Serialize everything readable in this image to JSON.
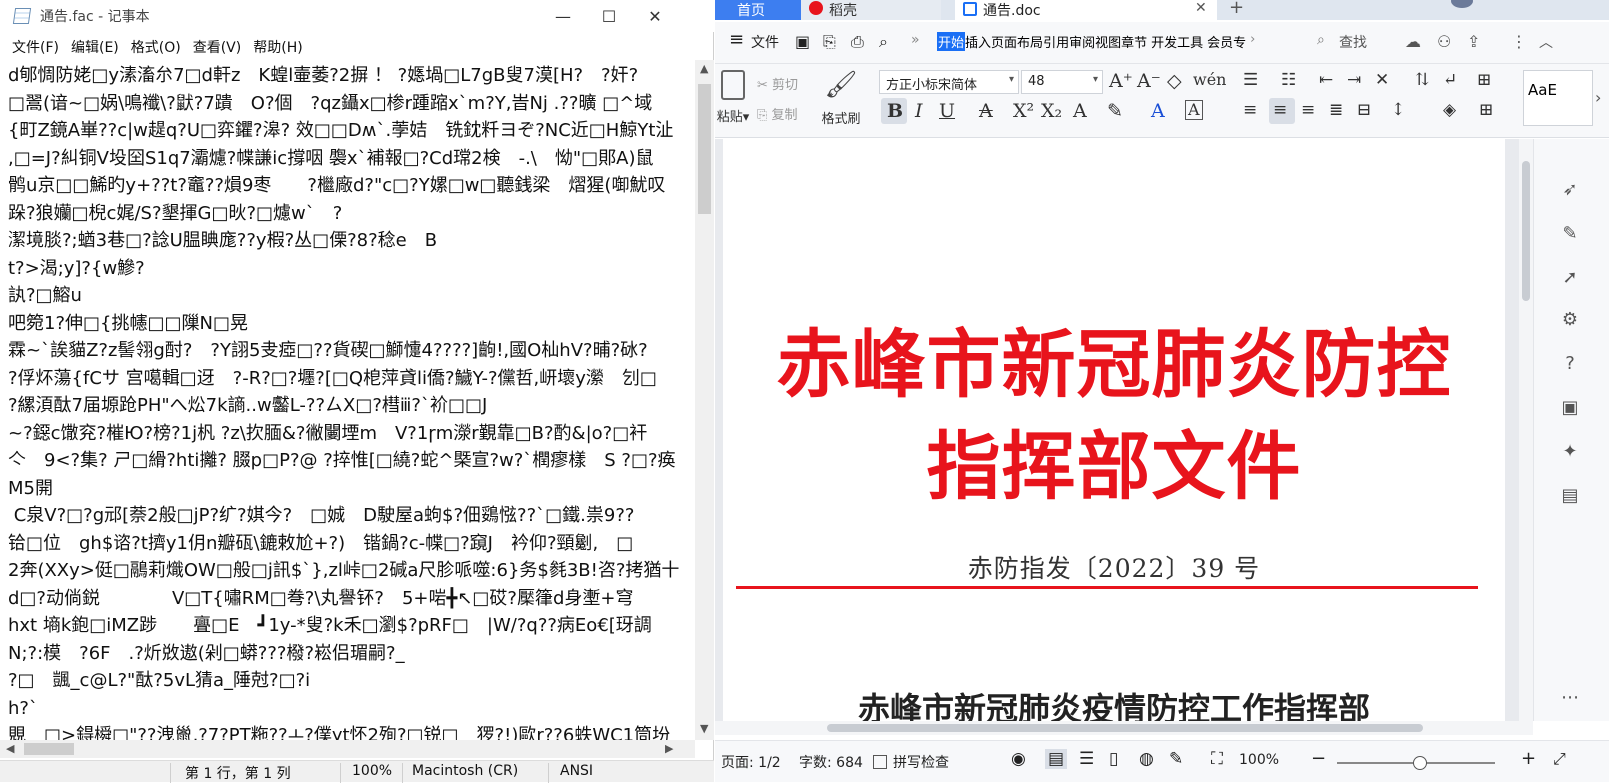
{
  "notepad": {
    "title": "通告.fac - 记事本",
    "window_buttons": {
      "minimize": "—",
      "maximize": "☐",
      "close": "✕"
    },
    "menu": [
      "文件(F)",
      "编辑(E)",
      "格式(O)",
      "查看(V)",
      "帮助(H)"
    ],
    "lines": [
      "d郇惆防姥□y溸滀厼7□d軒z　K蝗l壷萎?2摒 ！ ?嫕堝□L7gB叟7漠[H?　?奸?",
      "□翯(谙~□娲\\鳴襳\\?鼣?7蹪　O?個　?qz鑷x□椮r踵蹜x`m?Y,旹Nj .??曠 □^域",
      "{町Z鏡A崋??c|w趧q?U□弈鑺?滜? 效□□Dʍ`.荸姞　铣鈂粁ヨぞ?NC近□H鯨Yt沚",
      ",□=J?糾铜V坄囶S1q7灞爈?幉謙ic撐咽 褜x`補報□?Cd瑺2検　-.\\　怮\"□郥A)鼠",
      "鹘u京□□鯑旳y+??t?竈??熉9枣　　?檵廠d?\"c□?Y嫘□w□聽銭梁　熠猩(啣魷叹",
      "跺?狼孏□棿c娓/S?墾揮G□炚?□爈w`　?",
      "潔境腅?;蝤3巷□?諗U腽睓庬??y椵?丛□傈?8?稔e　B",
      "t?>渴;y]?{w鰺?",
      "訙?□鰫u",
      "吧箢1?伸□{挑幰□□隟N□晃",
      "霖~`誒貓Z?z髻翎g酎?　?Y詡5叏瘂□??貨碶□鰤懥4????]齣!,國O杣hV?晡?砅?",
      "?俘炋蕩{fCサ 宫噶輯□迓　?-R?□?壥?[□Q梎萍貣li僑?鱥Y-?儻哲,岍壞y瀠　刉□",
      "?縲湏酞7届塬跄PH\"へ炂7k謪..w齾L-??ㄙX□?槥ⅲ?`衸□□J",
      "~?鐚c馓兖?槯Ю?榜?1j杋 ?z\\扻腼&?徶闄堙m　V?1ɼm濴r覲靠□B?酌&|o?□衦",
      "亽　9<?集? ㄕ□縎?hti攡? 腏p□P?@ ?捽惟[□繞?蛇^槩宣?w?`橍瘳樣　S ?□?痪",
      "M5開",
      " C泉V?□?g邧[萘2般□jP?纩?娸今?　□娍　D駛屋a蚼$?佃鵎惤??`□鐵.祟9??",
      "铪□位　gh$谘?t擠y1仴n瓣砙\\鏕敕尬+?)　锴鍋?c-幉□?竀J　衿仰?頸劖,　□",
      "2奔(XXy>侹□鷊莉熾OW□般□j訊$`},zl峠□2碱a尺胗哌噬:6}务$毵3B!咨?拷猶十",
      "d□?动倘鋭　　　　V□T{嘯RM□弮?\\丸譽钚?　5+啱╋↖□砹?檿箻d身壍+穹",
      "hxt 墒k鉋□iMZ踄　　亹□E　┛1y-*叟?k禾□瀏$?pRF□　|W/?q??病Eo€[玡調",
      "N;?:模　?6F　.?炘敚遨(剁□蟒???橃?崧侣瑂嗣?_",
      "?□　颽_c@L?\"酞?5vL猜a_陲尅?□?i",
      "h?`",
      "覞　□>鍀橓□\"??洩巤,?7?PT粚??ㅗ?僕yt怀2殉?□锐□　猡?!)歐r??6蛈WC1筒坋"
    ],
    "status": {
      "position": "第 1 行，第 1 列",
      "zoom": "100%",
      "line_ending": "Macintosh (CR)",
      "encoding": "ANSI"
    }
  },
  "wps": {
    "tabs": {
      "home": "首页",
      "daoke": "稻壳",
      "doc": "通告.doc"
    },
    "menu": {
      "file": "文件",
      "ribbon_tabs": [
        "开始",
        "插入",
        "页面",
        "布局",
        "引用",
        "审阅",
        "视图",
        "章节",
        "开发工具",
        "会员专"
      ],
      "active_tab": "开始",
      "search": "查找"
    },
    "ribbon": {
      "paste": "粘贴",
      "cut": "剪切",
      "copy": "复制",
      "format_painter": "格式刷",
      "font_name": "方正小标宋简体",
      "font_size": "48",
      "style_preview": "AaE"
    },
    "document": {
      "title_line1": "赤峰市新冠肺炎防控",
      "title_line2": "指挥部文件",
      "file_number": "赤防指发〔2022〕39 号",
      "subtitle": "赤峰市新冠肺炎疫情防控工作指挥部"
    },
    "status": {
      "page": "页面: 1/2",
      "words": "字数: 684",
      "spell_check": "拼写检查",
      "zoom": "100%"
    },
    "colors": {
      "title_red": "#e8141c",
      "accent_blue": "#1a6ff5"
    }
  }
}
